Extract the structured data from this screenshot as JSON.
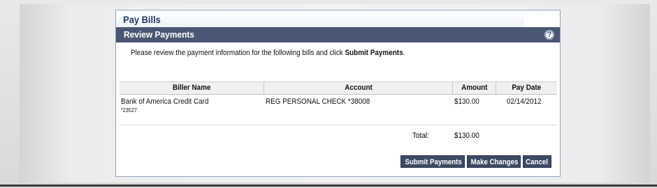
{
  "page": {
    "title": "Pay Bills",
    "section_title": "Review Payments",
    "help_icon": "?"
  },
  "instructions": {
    "text": "Please review the payment information for the following bills and click ",
    "emphasis": "Submit Payments",
    "suffix": "."
  },
  "table": {
    "columns": [
      "Biller Name",
      "Account",
      "Amount",
      "Pay Date"
    ],
    "rows": [
      {
        "biller": "Bank of America Credit Card",
        "biller_account": "*23527",
        "account": "REG PERSONAL CHECK *38008",
        "amount": "$130.00",
        "pay_date": "02/14/2012"
      }
    ]
  },
  "total": {
    "label": "Total:",
    "value": "$130.00"
  },
  "buttons": {
    "submit": "Submit Payments",
    "changes": "Make Changes",
    "cancel": "Cancel"
  },
  "colors": {
    "section_bar": "#4a5774",
    "title_text": "#1f3864",
    "button": "#3c4a66"
  }
}
